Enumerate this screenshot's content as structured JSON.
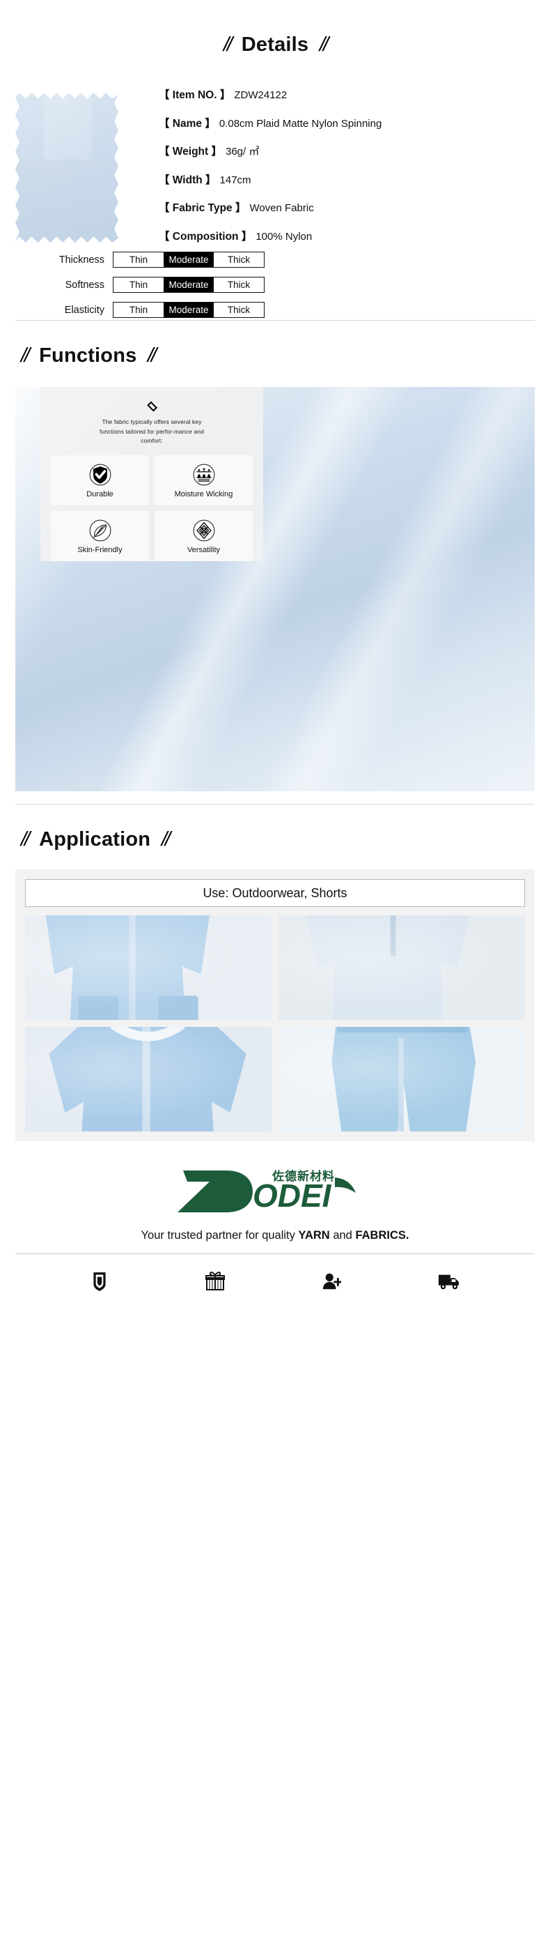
{
  "details": {
    "title": "Details",
    "slash_left": "//",
    "slash_right": "//",
    "specs": [
      {
        "label": "【 Item NO. 】",
        "value": "ZDW24122"
      },
      {
        "label": "【 Name 】",
        "value": "0.08cm Plaid Matte Nylon Spinning"
      },
      {
        "label": "【 Weight 】",
        "value": "36g/ ㎡"
      },
      {
        "label": "【 Width 】",
        "value": "147cm"
      },
      {
        "label": "【 Fabric Type 】",
        "value": "Woven Fabric"
      },
      {
        "label": "【 Composition 】",
        "value": "100% Nylon"
      }
    ],
    "ratings": [
      {
        "name": "Thickness",
        "options": [
          "Thin",
          "Moderate",
          "Thick"
        ],
        "selected": "Moderate"
      },
      {
        "name": "Softness",
        "options": [
          "Thin",
          "Moderate",
          "Thick"
        ],
        "selected": "Moderate"
      },
      {
        "name": "Elasticity",
        "options": [
          "Thin",
          "Moderate",
          "Thick"
        ],
        "selected": "Moderate"
      }
    ]
  },
  "functions": {
    "title": "Functions",
    "slash_left": "//",
    "slash_right": "//",
    "intro": "The fabric typically offers several key functions tailored for perfor-mance and comfort:",
    "cards": [
      {
        "label": "Durable",
        "icon": "shield-check-icon"
      },
      {
        "label": "Moisture Wicking",
        "icon": "moisture-wicking-icon"
      },
      {
        "label": "Skin-Friendly",
        "icon": "feather-icon"
      },
      {
        "label": "Versatility",
        "icon": "knot-icon"
      }
    ]
  },
  "application": {
    "title": "Application",
    "slash_left": "//",
    "slash_right": "//",
    "use_banner": "Use: Outdoorwear, Shorts",
    "photos": [
      {
        "alt": "light blue windbreaker jacket and shorts set"
      },
      {
        "alt": "light blue half-zip cropped jacket"
      },
      {
        "alt": "light blue hooded zip jacket"
      },
      {
        "alt": "light blue running shorts"
      }
    ]
  },
  "footer": {
    "brand_latin": "ODEI",
    "brand_cn": "佐德新材料",
    "tagline_pre": "Your trusted partner for quality ",
    "tagline_bold1": "YARN",
    "tagline_mid": " and ",
    "tagline_bold2": "FABRICS.",
    "brand_color": "#1d5c3a",
    "icons": [
      {
        "name": "shield-icon"
      },
      {
        "name": "gift-icon"
      },
      {
        "name": "add-user-icon"
      },
      {
        "name": "truck-icon"
      }
    ]
  }
}
